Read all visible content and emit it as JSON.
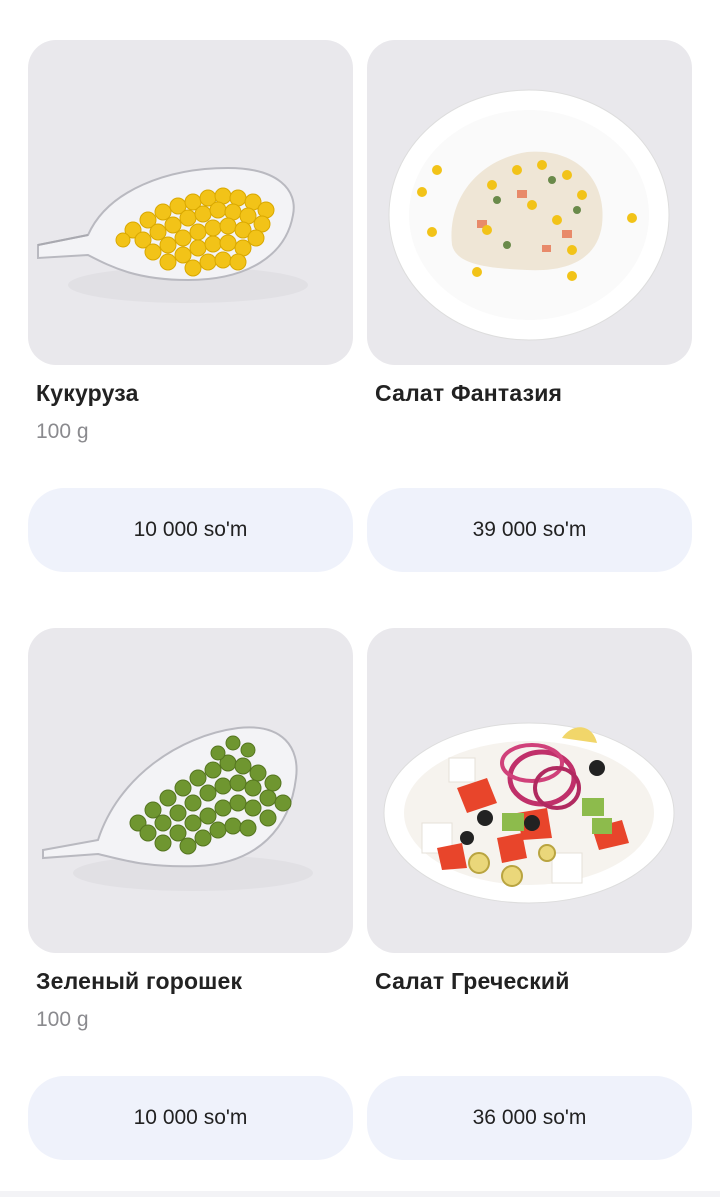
{
  "products": [
    {
      "name": "Кукуруза",
      "weight": "100 g",
      "price": "10 000 so'm",
      "image_icon": "corn-in-glass-bowl"
    },
    {
      "name": "Салат Фантазия",
      "weight": "",
      "price": "39 000 so'm",
      "image_icon": "salad-on-white-plate"
    },
    {
      "name": "Зеленый горошек",
      "weight": "100 g",
      "price": "10 000 so'm",
      "image_icon": "peas-in-glass-bowl"
    },
    {
      "name": "Салат Греческий",
      "weight": "",
      "price": "36 000 so'm",
      "image_icon": "greek-salad-bowl"
    }
  ],
  "colors": {
    "card_bg": "#e9e8ec",
    "price_bg": "#eff2fb",
    "text": "#222222",
    "muted": "#8a8a8e"
  }
}
